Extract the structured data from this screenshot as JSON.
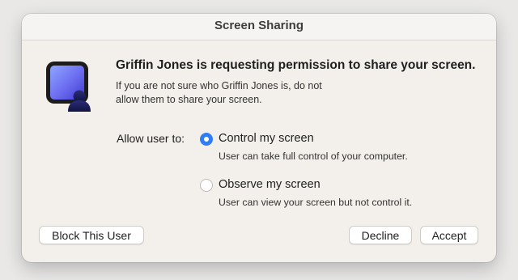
{
  "window": {
    "title": "Screen Sharing"
  },
  "dialog": {
    "icon": "screen-sharing-app-icon",
    "headline": "Griffin Jones is requesting permission to share your screen.",
    "subtext": "If you are not sure who Griffin Jones is, do not allow them to share your screen.",
    "allow_label": "Allow user to:",
    "options": [
      {
        "label": "Control my screen",
        "description": "User can take full control of your computer.",
        "selected": true
      },
      {
        "label": "Observe my screen",
        "description": "User can view your screen but not control it.",
        "selected": false
      }
    ]
  },
  "buttons": {
    "block": "Block This User",
    "decline": "Decline",
    "accept": "Accept"
  },
  "colors": {
    "accent": "#2f7ef6",
    "dialog_bg": "#f3efeb"
  }
}
